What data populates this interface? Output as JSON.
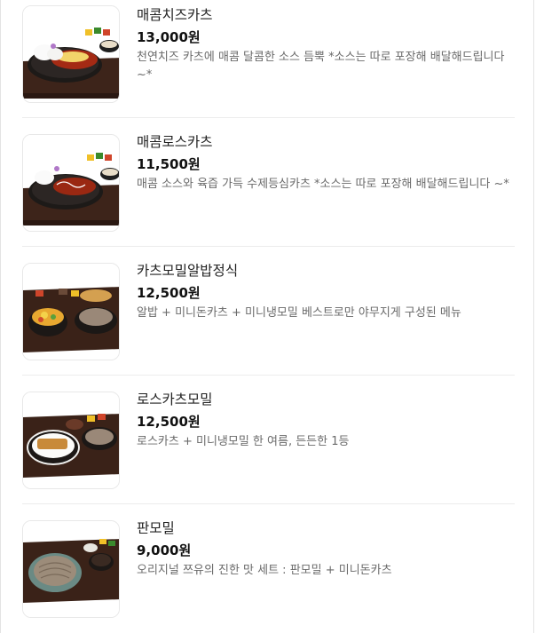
{
  "menu": {
    "items": [
      {
        "name": "매콤치즈카츠",
        "price": "13,000원",
        "description": "천연치즈 카츠에 매콤 달콤한 소스 듬뿍 *소스는 따로 포장해 배달해드립니다~*",
        "image_icon": "spicy-cheese-katsu-photo"
      },
      {
        "name": "매콤로스카츠",
        "price": "11,500원",
        "description": "매콤 소스와 육즙 가득 수제등심카츠 *소스는 따로 포장해 배달해드립니다 ~*",
        "image_icon": "spicy-loin-katsu-photo"
      },
      {
        "name": "카츠모밀알밥정식",
        "price": "12,500원",
        "description": "알밥 + 미니돈카츠 + 미니냉모밀 베스트로만 야무지게 구성된 메뉴",
        "image_icon": "katsu-soba-albap-set-photo"
      },
      {
        "name": "로스카츠모밀",
        "price": "12,500원",
        "description": "로스카츠 + 미니냉모밀 한 여름, 든든한 1등",
        "image_icon": "loin-katsu-soba-photo"
      },
      {
        "name": "판모밀",
        "price": "9,000원",
        "description": "오리지널 쯔유의 진한 맛 세트 : 판모밀 + 미니돈카츠",
        "image_icon": "pan-soba-photo"
      }
    ]
  }
}
